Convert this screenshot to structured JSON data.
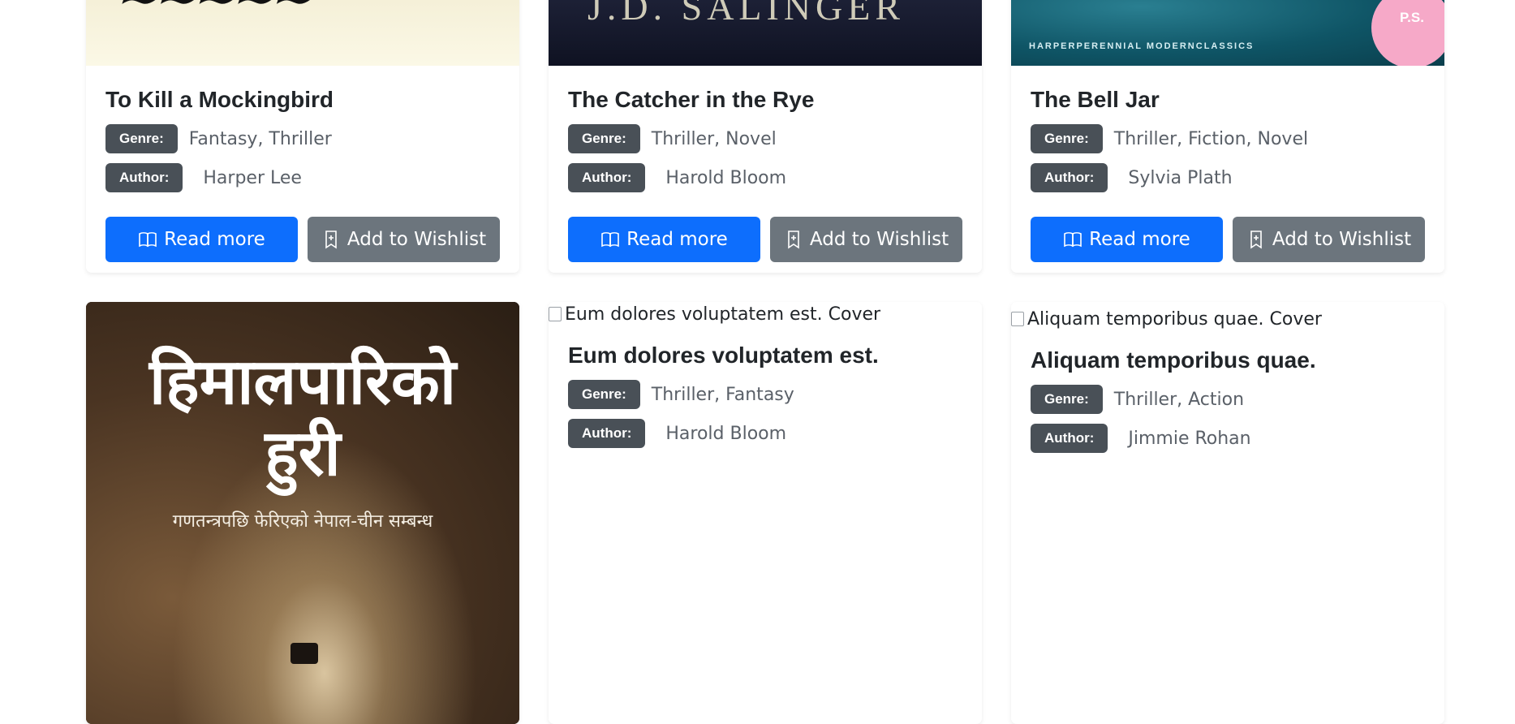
{
  "labels": {
    "genre": "Genre:",
    "author": "Author:",
    "read_more": "Read more",
    "add_wishlist": "Add to Wishlist"
  },
  "books": [
    {
      "title": "To Kill a Mockingbird",
      "genre": "Fantasy, Thriller",
      "author": "Harper Lee"
    },
    {
      "title": "The Catcher in the Rye",
      "genre": "Thriller, Novel",
      "author": "Harold Bloom",
      "cover_text": "J.D. SALINGER"
    },
    {
      "title": "The Bell Jar",
      "genre": "Thriller, Fiction, Novel",
      "author": "Sylvia Plath",
      "cover_publisher": "HARPERPERENNIAL MODERNCLASSICS",
      "cover_badge": "P.S."
    },
    {
      "title": "हिमालपारिको हुरी",
      "cover_line1": "हिमालपारिको",
      "cover_line2": "हुरी",
      "cover_subtitle": "गणतन्त्रपछि फेरिएको नेपाल-चीन सम्बन्ध"
    },
    {
      "title": "Eum dolores voluptatem est.",
      "cover_alt": "Eum dolores voluptatem est. Cover",
      "genre": "Thriller, Fantasy",
      "author": "Harold Bloom"
    },
    {
      "title": "Aliquam temporibus quae.",
      "cover_alt": "Aliquam temporibus quae. Cover",
      "genre": "Thriller, Action",
      "author": "Jimmie Rohan"
    }
  ],
  "colors": {
    "primary": "#0d6efd",
    "secondary": "#6c757d",
    "badge": "#495057"
  },
  "icons": {
    "read_more": "book-open-icon",
    "wishlist": "bookmark-plus-icon"
  }
}
